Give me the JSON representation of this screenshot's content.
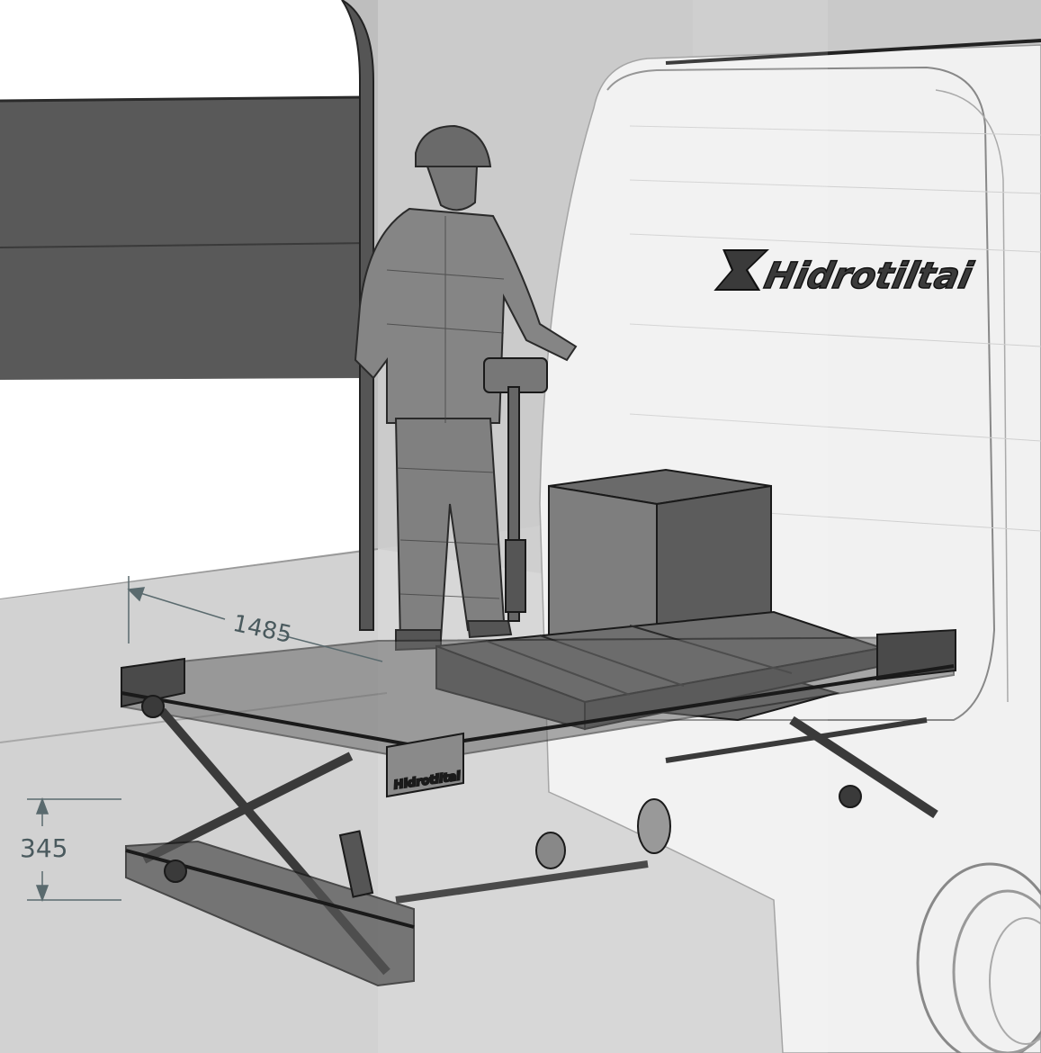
{
  "brand": {
    "name": "Hidrotiltai",
    "plate_text": "Hidrotiltai"
  },
  "dimensions": {
    "width_label": "1485",
    "height_label": "345"
  },
  "colors": {
    "background": "#cfcfcf",
    "wall": "#bdbdbd",
    "door_panel": "#5a5a5a",
    "van_body": "#f2f2f2",
    "metal_dark": "#3a3a3a",
    "dimension_line": "#5a6a6e"
  }
}
